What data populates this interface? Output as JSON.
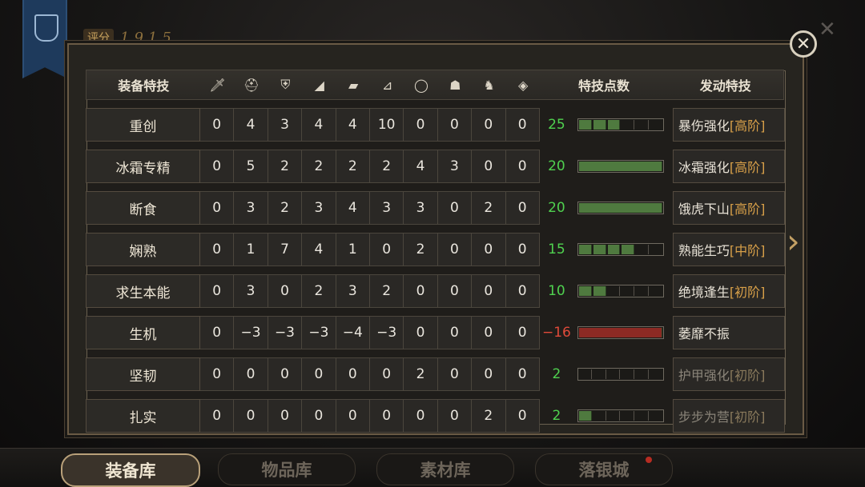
{
  "score": {
    "label": "评分",
    "value": "1915"
  },
  "header": {
    "name": "装备特技",
    "points": "特技点数",
    "activate": "发动特技",
    "slot_icons": [
      "sword-icon",
      "helmet-icon",
      "chest-armor-icon",
      "shoulder-icon",
      "bracer-icon",
      "boots-icon",
      "ring-icon",
      "mask-icon",
      "horse-icon",
      "amulet-icon"
    ]
  },
  "rows": [
    {
      "name": "重创",
      "vals": [
        "0",
        "4",
        "3",
        "4",
        "4",
        "10",
        "0",
        "0",
        "0",
        "0"
      ],
      "points": "25",
      "bar_fill": 0.58,
      "bar_color": "green",
      "skill": "暴伤强化",
      "level": "[高阶]",
      "dim": false
    },
    {
      "name": "冰霜专精",
      "vals": [
        "0",
        "5",
        "2",
        "2",
        "2",
        "2",
        "4",
        "3",
        "0",
        "0"
      ],
      "points": "20",
      "bar_fill": 1.0,
      "bar_color": "green",
      "skill": "冰霜强化",
      "level": "[高阶]",
      "dim": false
    },
    {
      "name": "断食",
      "vals": [
        "0",
        "3",
        "2",
        "3",
        "4",
        "3",
        "3",
        "0",
        "2",
        "0"
      ],
      "points": "20",
      "bar_fill": 1.0,
      "bar_color": "green",
      "skill": "饿虎下山",
      "level": "[高阶]",
      "dim": false
    },
    {
      "name": "娴熟",
      "vals": [
        "0",
        "1",
        "7",
        "4",
        "1",
        "0",
        "2",
        "0",
        "0",
        "0"
      ],
      "points": "15",
      "bar_fill": 0.67,
      "bar_color": "green",
      "skill": "熟能生巧",
      "level": "[中阶]",
      "dim": false
    },
    {
      "name": "求生本能",
      "vals": [
        "0",
        "3",
        "0",
        "2",
        "3",
        "2",
        "0",
        "0",
        "0",
        "0"
      ],
      "points": "10",
      "bar_fill": 0.33,
      "bar_color": "green",
      "skill": "绝境逢生",
      "level": "[初阶]",
      "dim": false
    },
    {
      "name": "生机",
      "vals": [
        "0",
        "−3",
        "−3",
        "−3",
        "−4",
        "−3",
        "0",
        "0",
        "0",
        "0"
      ],
      "points": "−16",
      "bar_fill": 1.0,
      "bar_color": "red",
      "skill": "萎靡不振",
      "level": "",
      "dim": false
    },
    {
      "name": "坚韧",
      "vals": [
        "0",
        "0",
        "0",
        "0",
        "0",
        "0",
        "2",
        "0",
        "0",
        "0"
      ],
      "points": "2",
      "bar_fill": 0.05,
      "bar_color": "green",
      "skill": "护甲强化",
      "level": "[初阶]",
      "dim": true
    },
    {
      "name": "扎实",
      "vals": [
        "0",
        "0",
        "0",
        "0",
        "0",
        "0",
        "0",
        "0",
        "2",
        "0"
      ],
      "points": "2",
      "bar_fill": 0.1,
      "bar_color": "green",
      "skill": "步步为营",
      "level": "[初阶]",
      "dim": true
    }
  ],
  "tabs": [
    "装备库",
    "物品库",
    "素材库",
    "落银城"
  ],
  "colors": {
    "points_positive": "#4fd14f",
    "points_negative": "#e04a3a",
    "level_tag": "#d8a049"
  }
}
